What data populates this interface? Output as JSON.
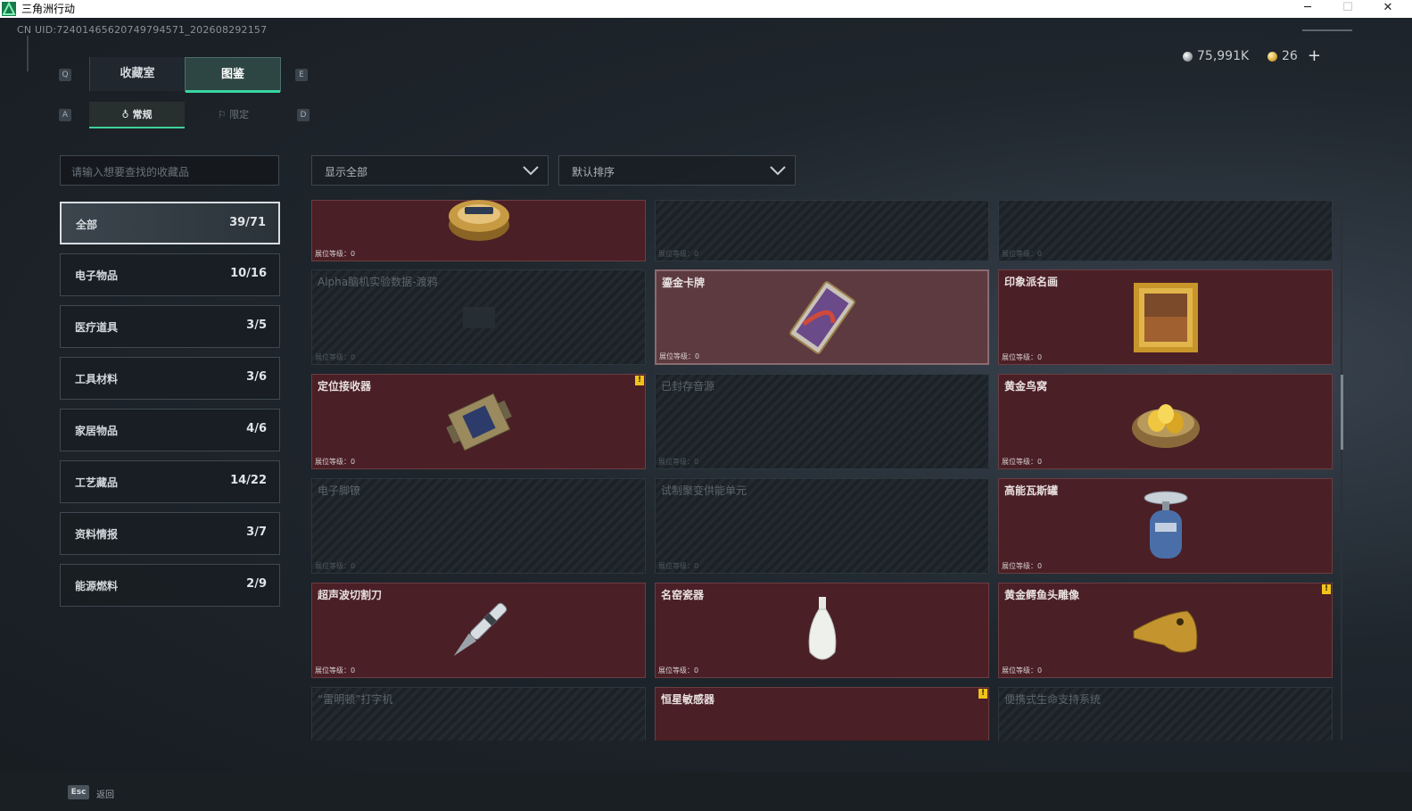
{
  "window": {
    "title": "三角洲行动",
    "minimize": "─",
    "maximize": "☐",
    "close": "✕"
  },
  "uid": "CN UID:72401465620749794571_202608292157",
  "currency": {
    "silver": "75,991K",
    "gold": "26",
    "plus": "+"
  },
  "keys": {
    "q": "Q",
    "e": "E",
    "a": "A",
    "d": "D"
  },
  "tabs": {
    "collection": "收藏室",
    "codex": "图鉴"
  },
  "subtabs": {
    "normal": "常规",
    "limited": "限定"
  },
  "search": {
    "placeholder": "请输入想要查找的收藏品"
  },
  "filters": {
    "show": "显示全部",
    "sort": "默认排序"
  },
  "categories": [
    {
      "label": "全部",
      "count": "39/71"
    },
    {
      "label": "电子物品",
      "count": "10/16"
    },
    {
      "label": "医疗道具",
      "count": "3/5"
    },
    {
      "label": "工具材料",
      "count": "3/6"
    },
    {
      "label": "家居物品",
      "count": "4/6"
    },
    {
      "label": "工艺藏品",
      "count": "14/22"
    },
    {
      "label": "资料情报",
      "count": "3/7"
    },
    {
      "label": "能源燃料",
      "count": "2/9"
    }
  ],
  "level_label": "展位等级：0",
  "cards": [
    {
      "name": "",
      "icon": "caviar-tin-icon"
    },
    {
      "name": "",
      "icon": "locked-item-icon"
    },
    {
      "name": "",
      "icon": "locked-item-icon"
    },
    {
      "name": "Alpha脑机实验数据-渡鸦",
      "icon": "locked-item-icon"
    },
    {
      "name": "鎏金卡牌",
      "icon": "gilded-card-icon"
    },
    {
      "name": "印象派名画",
      "icon": "framed-painting-icon"
    },
    {
      "name": "定位接收器",
      "icon": "locator-receiver-icon",
      "badge": "!"
    },
    {
      "name": "已封存音源",
      "icon": "locked-item-icon"
    },
    {
      "name": "黄金鸟窝",
      "icon": "golden-nest-icon"
    },
    {
      "name": "电子脚镣",
      "icon": "locked-item-icon"
    },
    {
      "name": "试制聚变供能单元",
      "icon": "locked-item-icon"
    },
    {
      "name": "高能瓦斯罐",
      "icon": "gas-canister-icon"
    },
    {
      "name": "超声波切割刀",
      "icon": "ultrasonic-knife-icon"
    },
    {
      "name": "名窑瓷器",
      "icon": "porcelain-vase-icon"
    },
    {
      "name": "黄金鳄鱼头雕像",
      "icon": "gold-crocodile-icon",
      "badge": "!"
    },
    {
      "name": "“雷明顿”打字机",
      "icon": "locked-item-icon"
    },
    {
      "name": "恒星敏感器",
      "icon": "star-sensor-icon",
      "badge": "!"
    },
    {
      "name": "便携式生命支持系统",
      "icon": "locked-item-icon"
    }
  ],
  "footer": {
    "esc_key": "Esc",
    "back": "返回"
  }
}
